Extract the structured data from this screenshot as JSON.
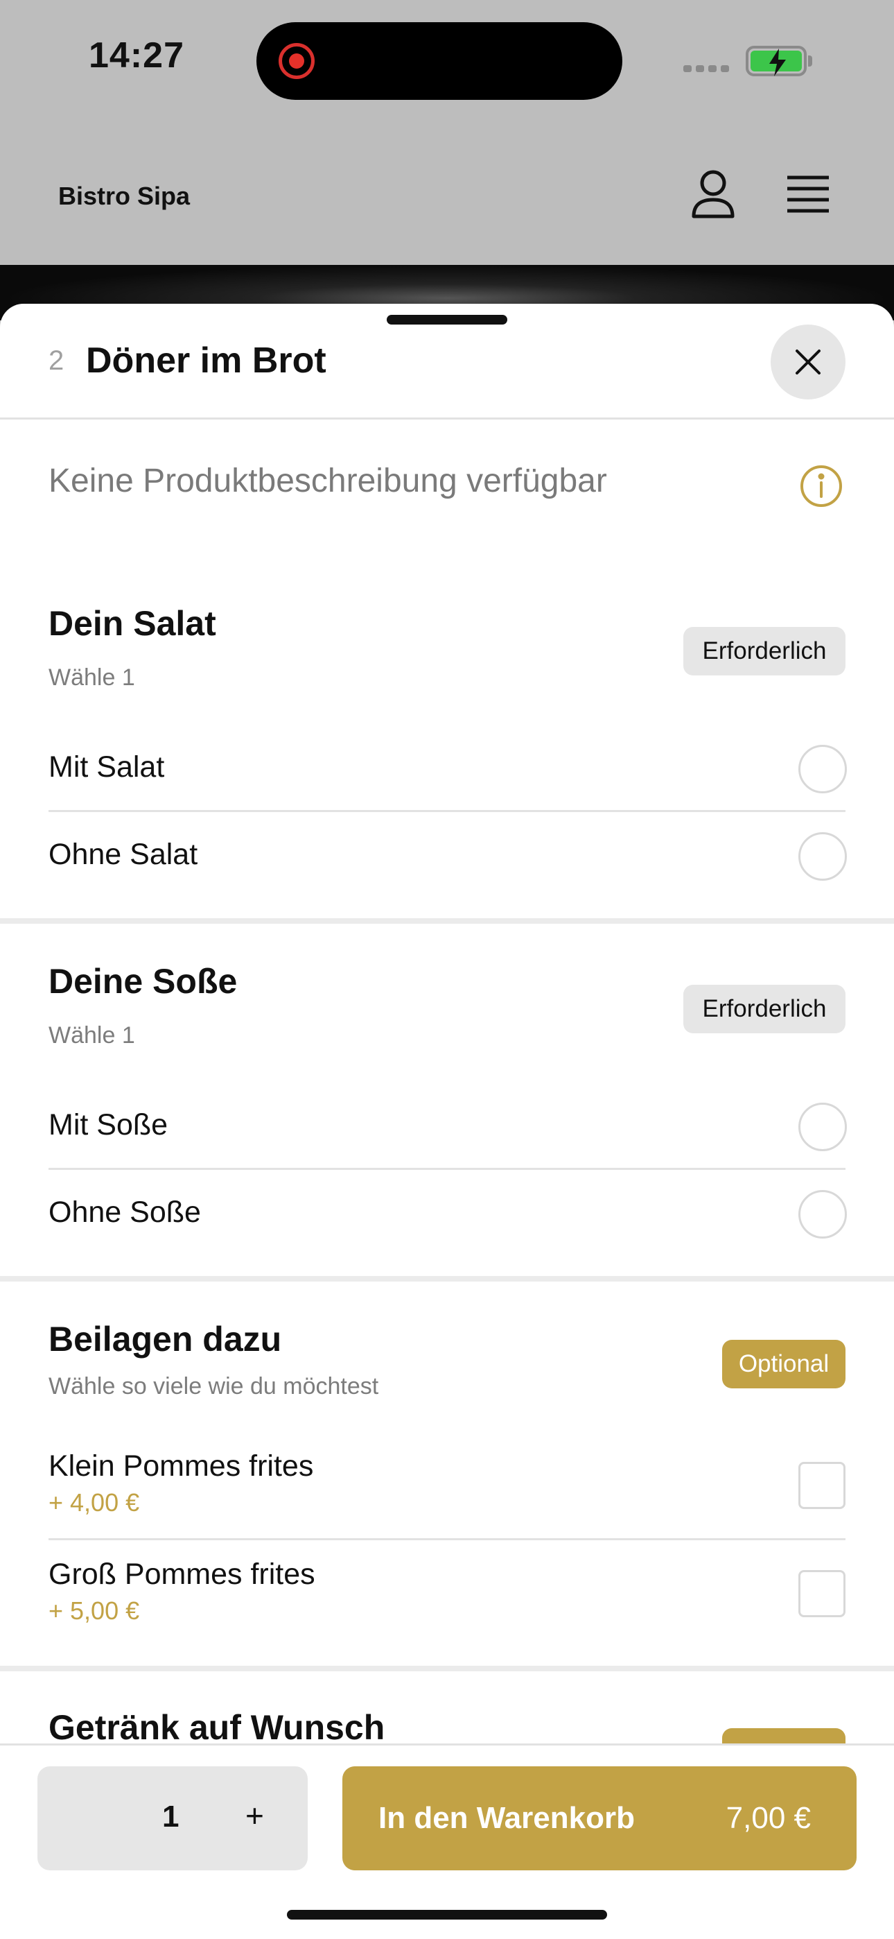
{
  "status": {
    "time": "14:27"
  },
  "header": {
    "brand": "Bistro Sipa"
  },
  "sheet": {
    "index": "2",
    "title": "Döner im Brot",
    "description": "Keine Produktbeschreibung verfügbar"
  },
  "groups": [
    {
      "title": "Dein Salat",
      "subtitle": "Wähle 1",
      "badge": "Erforderlich",
      "options": [
        {
          "label": "Mit Salat"
        },
        {
          "label": "Ohne Salat"
        }
      ]
    },
    {
      "title": "Deine Soße",
      "subtitle": "Wähle 1",
      "badge": "Erforderlich",
      "options": [
        {
          "label": "Mit Soße"
        },
        {
          "label": "Ohne Soße"
        }
      ]
    },
    {
      "title": "Beilagen dazu",
      "subtitle": "Wähle so viele wie du möchtest",
      "badge": "Optional",
      "options": [
        {
          "label": "Klein Pommes frites",
          "price": "+ 4,00 €"
        },
        {
          "label": "Groß Pommes frites",
          "price": "+ 5,00 €"
        }
      ]
    },
    {
      "title": "Getränk auf Wunsch"
    }
  ],
  "footer": {
    "quantity": "1",
    "plus": "+",
    "cart_label": "In den Warenkorb",
    "cart_price": "7,00 €"
  },
  "colors": {
    "accent": "#c2a245",
    "badge_gray": "#e6e6e6"
  }
}
